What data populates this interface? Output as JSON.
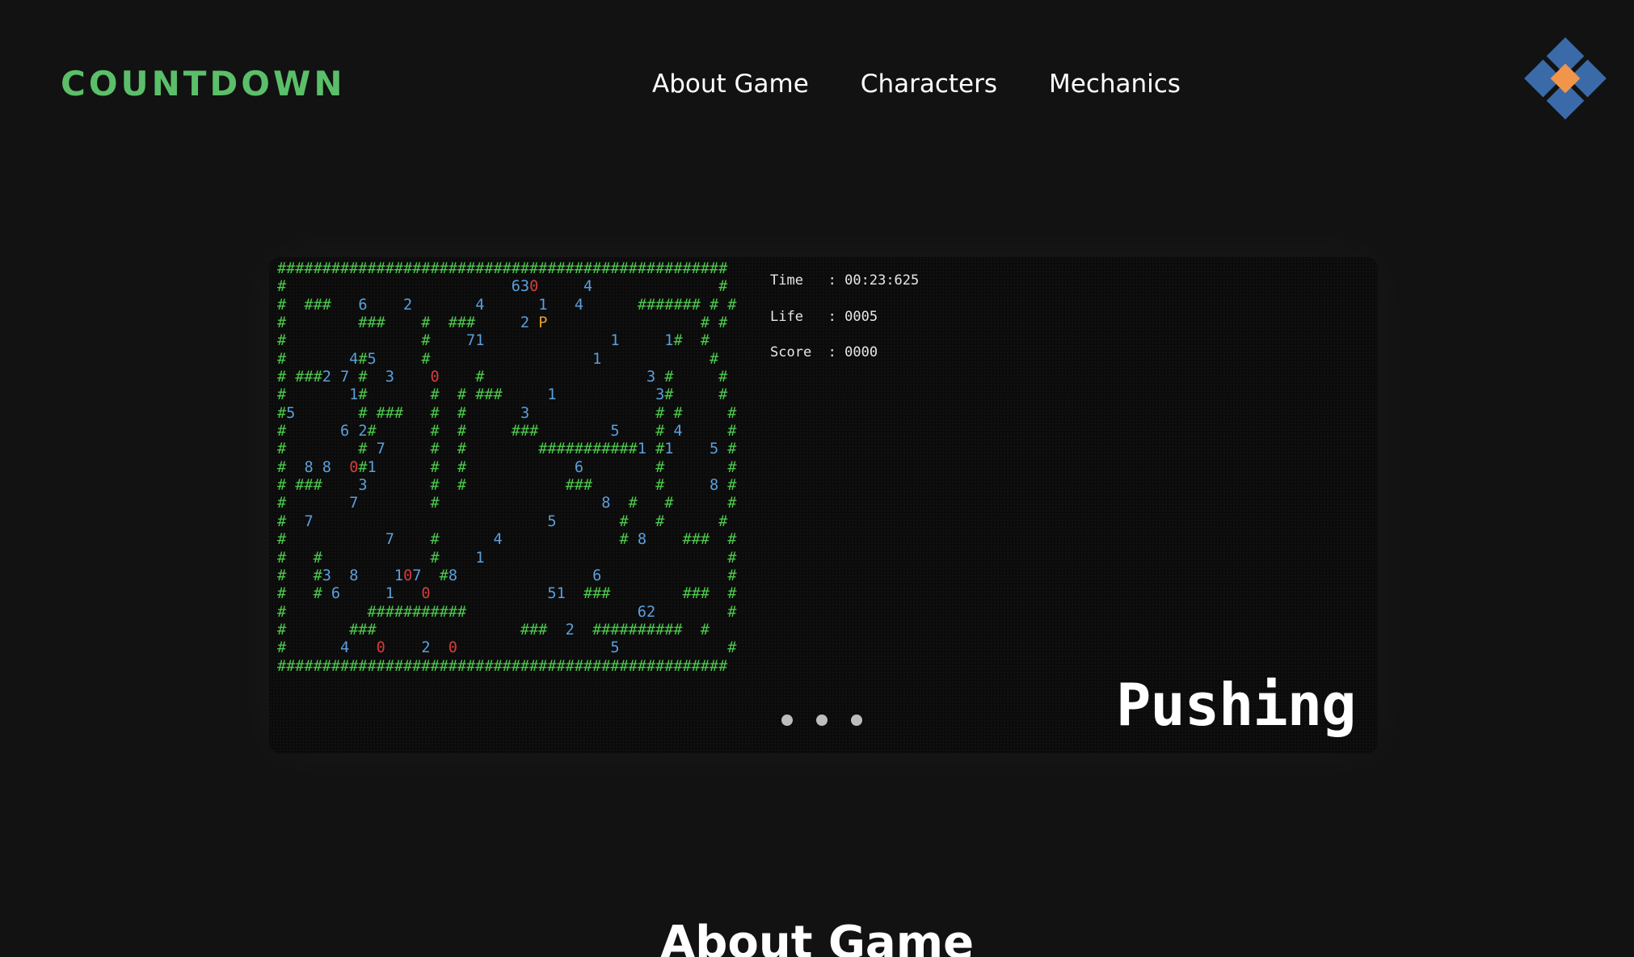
{
  "header": {
    "logo_text": "COUNTDOWN",
    "nav": [
      "About Game",
      "Characters",
      "Mechanics"
    ],
    "brand_icon": "diamond-logo-icon"
  },
  "game": {
    "maze_rows": [
      "##################################################",
      "#                         630     4              #",
      "#  ###   6    2       4      1   4      ####### # #",
      "#        ###    #  ###     2 P                 # #",
      "#               #    71              1     1#  #",
      "#       4#5     #                  1            #",
      "# ###2 7 #  3    0    #                  3 #     #",
      "#       1#       #  # ###     1           3#     #",
      "#5       # ###   #  #      3              # #     #",
      "#      6 2#      #  #     ###        5    # 4     #",
      "#        # 7     #  #        ###########1 #1    5 #",
      "#  8 8  0#1      #  #            6        #       #",
      "# ###    3       #  #           ###       #     8 #",
      "#       7        #                  8  #   #      #",
      "#  7                          5       #   #      #",
      "#           7    #      4             # 8    ###  #",
      "#   #            #    1                           #",
      "#   #3  8    107  #8               6              #",
      "#   # 6     1   0             51  ###        ###  #",
      "#         ###########                   62        #",
      "#       ###                ###  2  ##########  #",
      "#      4   0    2  0                 5            #",
      "##################################################"
    ],
    "stats": [
      {
        "label": "Time",
        "value": "00:23:625"
      },
      {
        "label": "Life",
        "value": "0005"
      },
      {
        "label": "Score",
        "value": "0000"
      }
    ],
    "mechanic_label": "Pushing",
    "carousel_count": 3
  },
  "section": {
    "title": "About Game"
  },
  "colors": {
    "background": "#121212",
    "accent_green": "#5bbf6a",
    "wall_green": "#4cc94c",
    "number_blue": "#5b9fdc",
    "zero_red": "#d43c3c",
    "player_orange": "#e0a030",
    "logo_blue": "#3a6aa8",
    "logo_orange": "#f0954a"
  }
}
